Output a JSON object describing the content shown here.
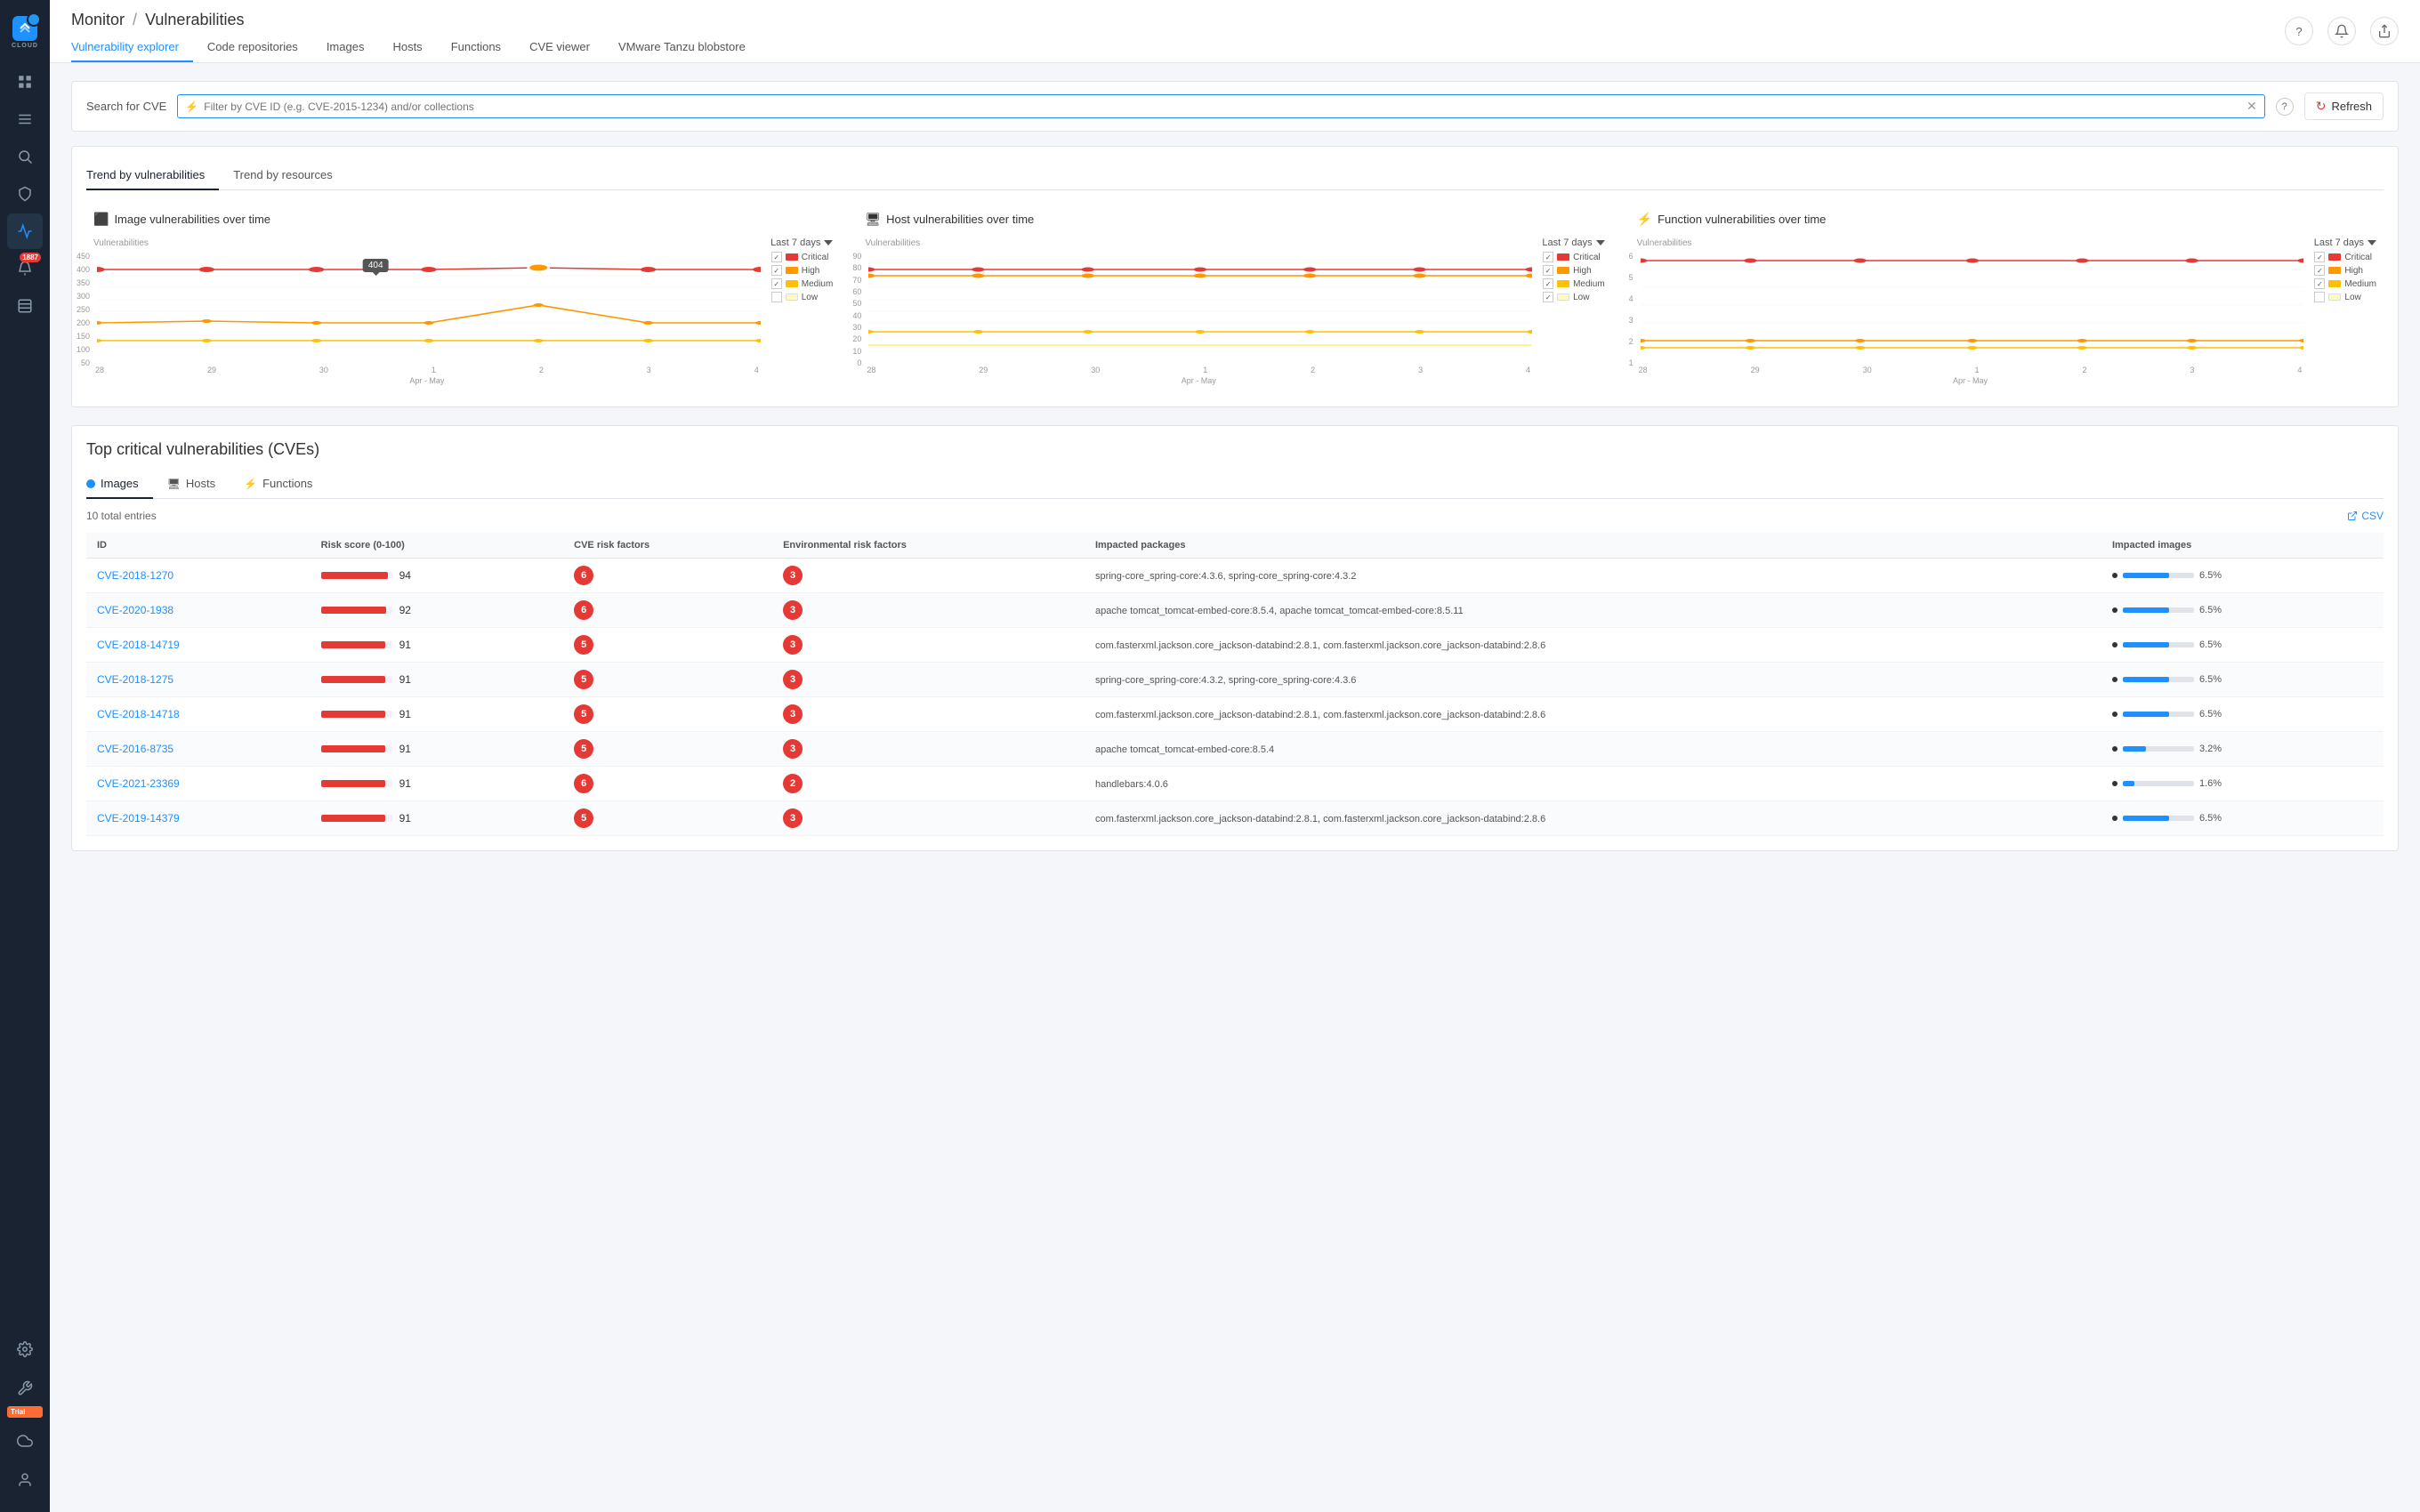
{
  "app": {
    "logo": "CLOUD",
    "title": "Monitor",
    "subtitle": "Vulnerabilities"
  },
  "topbar": {
    "nav_items": [
      {
        "id": "vulnerability-explorer",
        "label": "Vulnerability explorer",
        "active": true
      },
      {
        "id": "code-repositories",
        "label": "Code repositories",
        "active": false
      },
      {
        "id": "images",
        "label": "Images",
        "active": false
      },
      {
        "id": "hosts",
        "label": "Hosts",
        "active": false
      },
      {
        "id": "functions",
        "label": "Functions",
        "active": false
      },
      {
        "id": "cve-viewer",
        "label": "CVE viewer",
        "active": false
      },
      {
        "id": "vmware-tanzu",
        "label": "VMware Tanzu blobstore",
        "active": false
      }
    ]
  },
  "search": {
    "label": "Search for CVE",
    "placeholder": "Filter by CVE ID (e.g. CVE-2015-1234) and/or collections",
    "value": ""
  },
  "refresh_button": "Refresh",
  "trend": {
    "tab1": "Trend by vulnerabilities",
    "tab2": "Trend by resources",
    "charts": [
      {
        "id": "image-chart",
        "icon": "🖼",
        "title": "Image vulnerabilities over time",
        "y_label": "Vulnerabilities",
        "period": "Last 7 days",
        "x_labels": [
          "28",
          "29",
          "30",
          "1",
          "2",
          "3",
          "4"
        ],
        "x_period": "Apr - May",
        "y_max": 450,
        "y_ticks": [
          "450",
          "400",
          "350",
          "300",
          "250",
          "200",
          "150",
          "100",
          "50"
        ],
        "tooltip": {
          "value": "404",
          "x_index": 4
        },
        "series": {
          "critical": {
            "color": "#e53935",
            "label": "Critical"
          },
          "high": {
            "color": "#ff9800",
            "label": "High"
          },
          "medium": {
            "color": "#ffc107",
            "label": "Medium"
          },
          "low": {
            "color": "#ffecb3",
            "label": "Low"
          }
        }
      },
      {
        "id": "host-chart",
        "icon": "🖥",
        "title": "Host vulnerabilities over time",
        "y_label": "Vulnerabilities",
        "period": "Last 7 days",
        "x_labels": [
          "28",
          "29",
          "30",
          "1",
          "2",
          "3",
          "4"
        ],
        "x_period": "Apr - May",
        "y_max": 90,
        "y_ticks": [
          "90",
          "80",
          "70",
          "60",
          "50",
          "40",
          "30",
          "20",
          "10",
          "0"
        ],
        "series": {
          "critical": {
            "color": "#e53935",
            "label": "Critical"
          },
          "high": {
            "color": "#ff9800",
            "label": "High"
          },
          "medium": {
            "color": "#ffc107",
            "label": "Medium"
          },
          "low": {
            "color": "#ffecb3",
            "label": "Low"
          }
        }
      },
      {
        "id": "function-chart",
        "icon": "⚡",
        "title": "Function vulnerabilities over time",
        "y_label": "Vulnerabilities",
        "period": "Last 7 days",
        "x_labels": [
          "28",
          "29",
          "30",
          "1",
          "2",
          "3",
          "4"
        ],
        "x_period": "Apr - May",
        "y_max": 6,
        "y_ticks": [
          "6",
          "5",
          "4",
          "3",
          "2",
          "1"
        ],
        "series": {
          "critical": {
            "color": "#e53935",
            "label": "Critical"
          },
          "high": {
            "color": "#ff9800",
            "label": "High"
          },
          "medium": {
            "color": "#ffc107",
            "label": "Medium"
          },
          "low": {
            "color": "#ffecb3",
            "label": "Low"
          }
        }
      }
    ]
  },
  "cve_section": {
    "title": "Top critical vulnerabilities (CVEs)",
    "tabs": [
      {
        "id": "images",
        "label": "Images",
        "type": "dot",
        "active": true
      },
      {
        "id": "hosts",
        "label": "Hosts",
        "type": "icon",
        "active": false
      },
      {
        "id": "functions",
        "label": "Functions",
        "type": "icon",
        "active": false
      }
    ],
    "total_entries": "10 total entries",
    "csv_label": "CSV",
    "columns": [
      "ID",
      "Risk score (0-100)",
      "CVE risk factors",
      "Environmental risk factors",
      "Impacted packages",
      "Impacted images"
    ],
    "rows": [
      {
        "id": "CVE-2018-1270",
        "risk_score": 94,
        "cve_risk": 6,
        "env_risk": 3,
        "packages": "spring-core_spring-core:4.3.6, spring-core_spring-core:4.3.2",
        "impact_pct": 6.5
      },
      {
        "id": "CVE-2020-1938",
        "risk_score": 92,
        "cve_risk": 6,
        "env_risk": 3,
        "packages": "apache tomcat_tomcat-embed-core:8.5.4, apache tomcat_tomcat-embed-core:8.5.11",
        "impact_pct": 6.5
      },
      {
        "id": "CVE-2018-14719",
        "risk_score": 91,
        "cve_risk": 5,
        "env_risk": 3,
        "packages": "com.fasterxml.jackson.core_jackson-databind:2.8.1, com.fasterxml.jackson.core_jackson-databind:2.8.6",
        "impact_pct": 6.5
      },
      {
        "id": "CVE-2018-1275",
        "risk_score": 91,
        "cve_risk": 5,
        "env_risk": 3,
        "packages": "spring-core_spring-core:4.3.2, spring-core_spring-core:4.3.6",
        "impact_pct": 6.5
      },
      {
        "id": "CVE-2018-14718",
        "risk_score": 91,
        "cve_risk": 5,
        "env_risk": 3,
        "packages": "com.fasterxml.jackson.core_jackson-databind:2.8.1, com.fasterxml.jackson.core_jackson-databind:2.8.6",
        "impact_pct": 6.5
      },
      {
        "id": "CVE-2016-8735",
        "risk_score": 91,
        "cve_risk": 5,
        "env_risk": 3,
        "packages": "apache tomcat_tomcat-embed-core:8.5.4",
        "impact_pct": 3.2
      },
      {
        "id": "CVE-2021-23369",
        "risk_score": 91,
        "cve_risk": 6,
        "env_risk": 2,
        "packages": "handlebars:4.0.6",
        "impact_pct": 1.6
      },
      {
        "id": "CVE-2019-14379",
        "risk_score": 91,
        "cve_risk": 5,
        "env_risk": 3,
        "packages": "com.fasterxml.jackson.core_jackson-databind:2.8.1, com.fasterxml.jackson.core_jackson-databind:2.8.6",
        "impact_pct": 6.5
      }
    ]
  },
  "sidebar": {
    "items": [
      {
        "id": "dashboard",
        "icon": "dashboard"
      },
      {
        "id": "inventory",
        "icon": "list"
      },
      {
        "id": "search",
        "icon": "search"
      },
      {
        "id": "defend",
        "icon": "shield"
      },
      {
        "id": "monitor",
        "icon": "chart",
        "active": true
      },
      {
        "id": "alerts",
        "icon": "bell",
        "badge": "1887"
      },
      {
        "id": "books",
        "icon": "book"
      }
    ],
    "bottom_items": [
      {
        "id": "settings",
        "icon": "gear"
      },
      {
        "id": "wrench",
        "icon": "wrench",
        "trial": true
      },
      {
        "id": "cloud2",
        "icon": "cloud"
      },
      {
        "id": "user",
        "icon": "user"
      }
    ]
  }
}
